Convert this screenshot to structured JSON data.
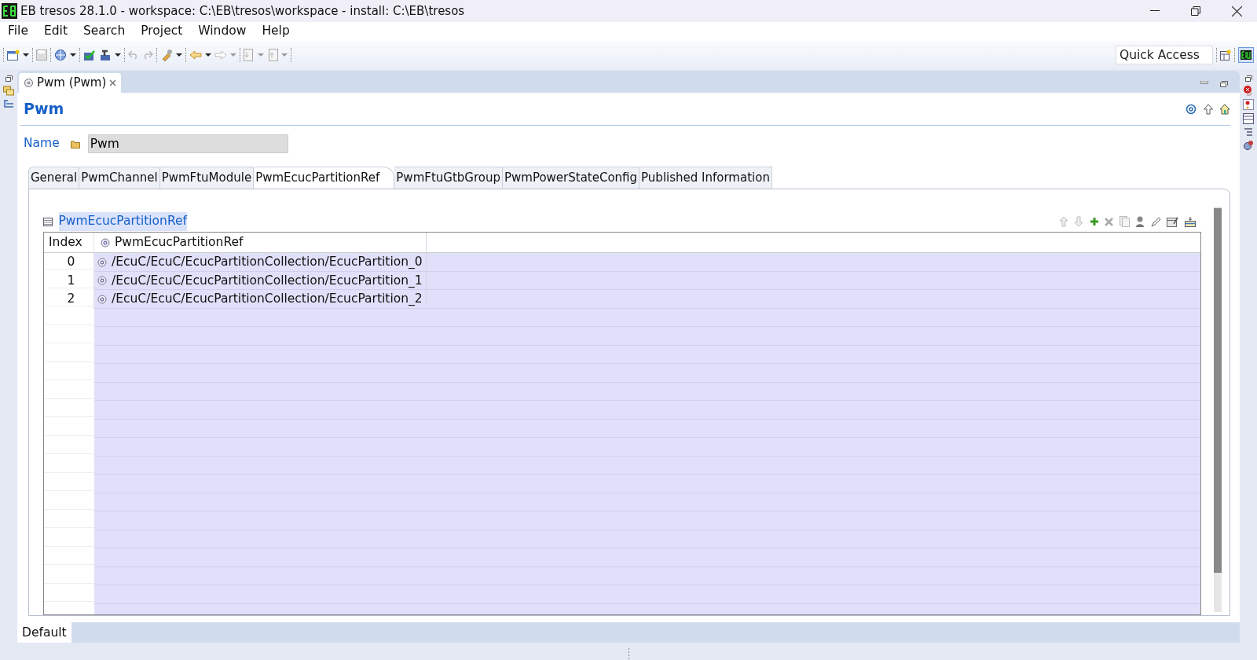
{
  "window": {
    "title": "EB tresos 28.1.0 - workspace: C:\\EB\\tresos\\workspace - install: C:\\EB\\tresos"
  },
  "menu": [
    "File",
    "Edit",
    "Search",
    "Project",
    "Window",
    "Help"
  ],
  "quick_access": {
    "placeholder": "Quick Access"
  },
  "editor_tab": {
    "label": "Pwm (Pwm)"
  },
  "form": {
    "title": "Pwm",
    "name_label": "Name",
    "name_value": "Pwm"
  },
  "tabs": [
    {
      "label": "General",
      "selected": false
    },
    {
      "label": "PwmChannel",
      "selected": false
    },
    {
      "label": "PwmFtuModule",
      "selected": false
    },
    {
      "label": "PwmEcucPartitionRef",
      "selected": true
    },
    {
      "label": "PwmFtuGtbGroup",
      "selected": false
    },
    {
      "label": "PwmPowerStateConfig",
      "selected": false
    },
    {
      "label": "Published Information",
      "selected": false
    }
  ],
  "section": {
    "title": "PwmEcucPartitionRef"
  },
  "table": {
    "columns": [
      "Index",
      "PwmEcucPartitionRef"
    ],
    "rows": [
      {
        "index": "0",
        "value": "/EcuC/EcuC/EcucPartitionCollection/EcucPartition_0"
      },
      {
        "index": "1",
        "value": "/EcuC/EcuC/EcucPartitionCollection/EcucPartition_1"
      },
      {
        "index": "2",
        "value": "/EcuC/EcuC/EcucPartitionCollection/EcucPartition_2"
      }
    ]
  },
  "bottom_tabs": [
    {
      "label": "Default",
      "selected": true
    }
  ]
}
